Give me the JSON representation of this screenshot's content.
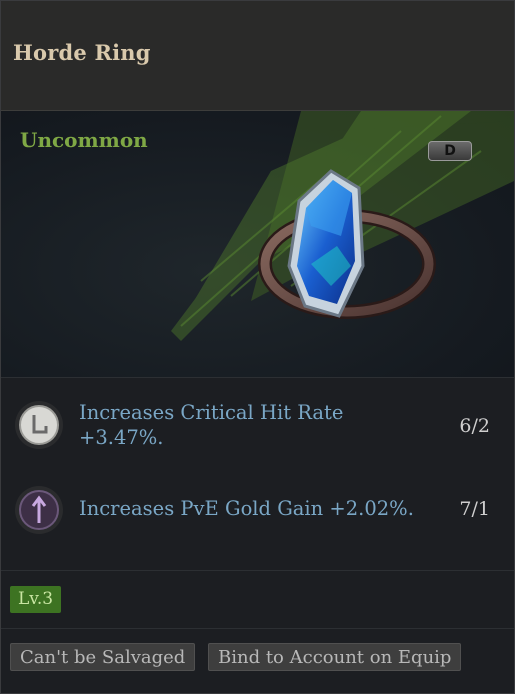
{
  "item": {
    "name": "Horde Ring",
    "rarity": "Uncommon",
    "grade": "D",
    "level": "Lv.3"
  },
  "stats": [
    {
      "text": "Increases Critical Hit Rate +3.47%.",
      "value": "6/2",
      "icon": "rune-crit-icon"
    },
    {
      "text": "Increases PvE Gold Gain +2.02%.",
      "value": "7/1",
      "icon": "rune-gold-icon"
    }
  ],
  "tags": [
    "Can't be Salvaged",
    "Bind to Account on Equip"
  ],
  "colors": {
    "rarity": "#7fa845",
    "stat_text": "#7aa7c6",
    "level_badge": "#3d7322"
  }
}
